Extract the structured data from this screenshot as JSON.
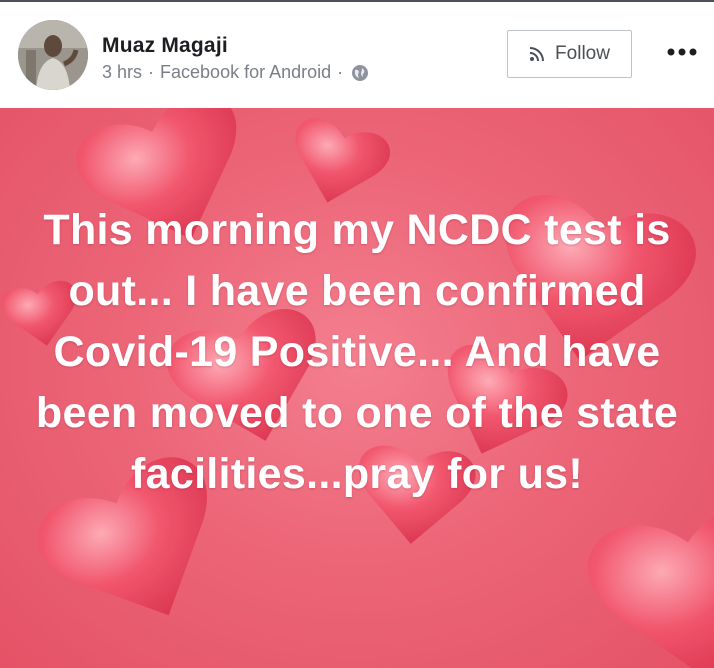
{
  "post": {
    "author": "Muaz Magaji",
    "time": "3 hrs",
    "separator": "·",
    "source": "Facebook for Android",
    "separator2": "·",
    "privacy_icon": "globe-icon",
    "follow_label": "Follow",
    "follow_icon": "rss-icon",
    "more_icon": "more-dots-icon",
    "text": "This morning my NCDC test is out... I have been confirmed Covid-19 Positive... And have been moved to one of the state facilities...pray for us!",
    "background_color": "#ec6678",
    "text_color": "#ffffff"
  }
}
